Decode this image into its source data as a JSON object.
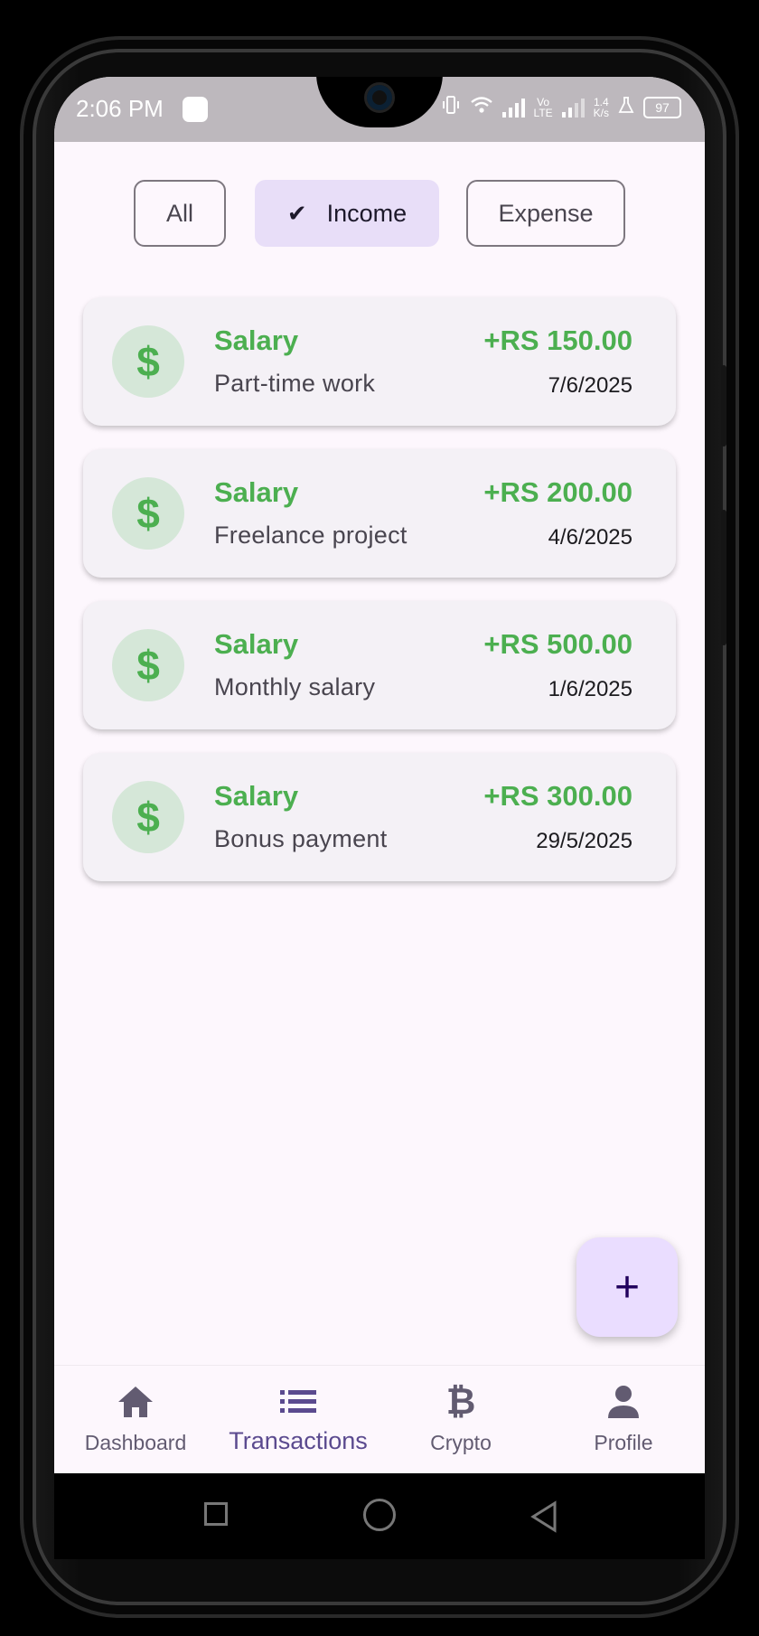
{
  "status_bar": {
    "time": "2:06 PM",
    "network_speed_value": "1.4",
    "network_speed_unit": "K/s",
    "volte_label_top": "Vo",
    "volte_label_bottom": "LTE",
    "battery": "97"
  },
  "filters": [
    {
      "label": "All",
      "selected": false
    },
    {
      "label": "Income",
      "selected": true
    },
    {
      "label": "Expense",
      "selected": false
    }
  ],
  "transactions": [
    {
      "category": "Salary",
      "description": "Part-time work",
      "amount": "+RS 150.00",
      "date": "7/6/2025",
      "icon": "dollar-icon"
    },
    {
      "category": "Salary",
      "description": "Freelance project",
      "amount": "+RS 200.00",
      "date": "4/6/2025",
      "icon": "dollar-icon"
    },
    {
      "category": "Salary",
      "description": "Monthly salary",
      "amount": "+RS 500.00",
      "date": "1/6/2025",
      "icon": "dollar-icon"
    },
    {
      "category": "Salary",
      "description": "Bonus payment",
      "amount": "+RS 300.00",
      "date": "29/5/2025",
      "icon": "dollar-icon"
    }
  ],
  "fab": {
    "icon": "plus-icon",
    "symbol": "+"
  },
  "bottom_nav": [
    {
      "label": "Dashboard",
      "icon": "home-icon",
      "active": false
    },
    {
      "label": "Transactions",
      "icon": "list-icon",
      "active": true
    },
    {
      "label": "Crypto",
      "icon": "bitcoin-icon",
      "active": false
    },
    {
      "label": "Profile",
      "icon": "person-icon",
      "active": false
    }
  ],
  "colors": {
    "income_green": "#4caf50",
    "selected_chip": "#e8def8",
    "fab_background": "#eaddff",
    "active_nav": "#5b4a8f",
    "screen_background": "#fdf7fd"
  }
}
